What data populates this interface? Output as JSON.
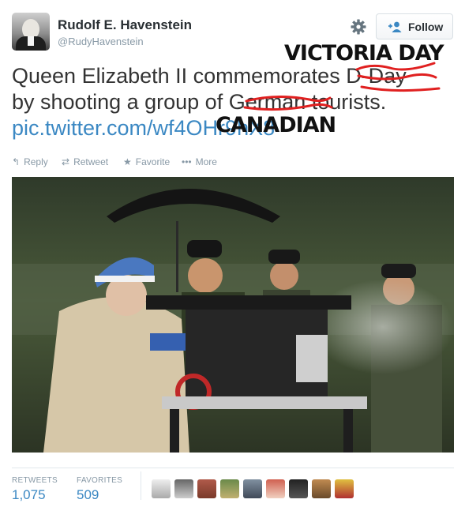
{
  "user": {
    "name": "Rudolf E. Havenstein",
    "handle": "@RudyHavenstein"
  },
  "follow_label": "Follow",
  "tweet": {
    "line1": "Queen Elizabeth II commemorates D-Day",
    "line2_prefix": "by shooting a group of ",
    "line2_struck": "German",
    "line2_suffix": " tourists.",
    "link": "pic.twitter.com/wf4OHr9hX8"
  },
  "overlays": {
    "top": "VICTORIA DAY",
    "bottom": "CANADIAN"
  },
  "actions": {
    "reply": "Reply",
    "retweet": "Retweet",
    "favorite": "Favorite",
    "more": "More"
  },
  "stats": {
    "retweets_label": "RETWEETS",
    "retweets_value": "1,075",
    "favorites_label": "FAVORITES",
    "favorites_value": "509"
  },
  "colors": {
    "link": "#3b88c3",
    "scribble": "#e02020",
    "muted": "#8899a6"
  },
  "icons": {
    "gear": "gear-icon",
    "follow": "add-user-icon",
    "reply": "reply-icon",
    "retweet": "retweet-icon",
    "favorite": "star-icon",
    "more": "more-dots-icon"
  }
}
